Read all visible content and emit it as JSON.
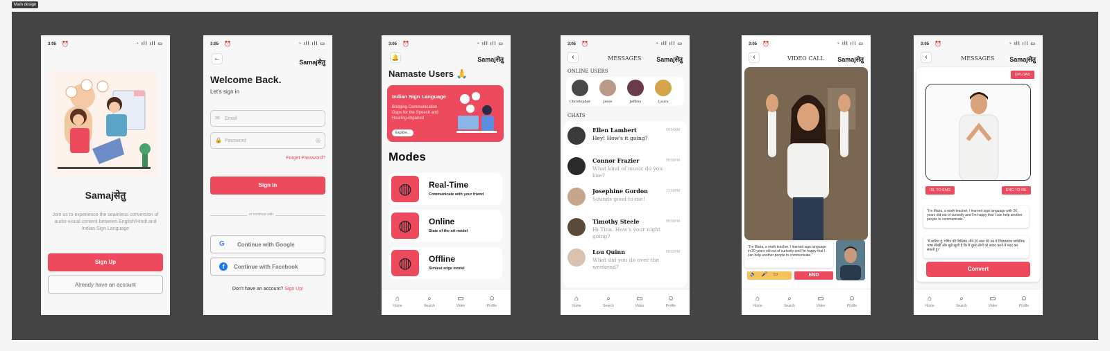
{
  "frame_label": "Main design",
  "status": {
    "time": "3:05",
    "icons": "◔ ıll ıll ▭"
  },
  "brand": "Samajसेतु",
  "screen1": {
    "title": "Samajसेतु",
    "description": "Join us to experience the seamless conversion of audio-visual content between English/Hindi and Indian Sign Language",
    "signup": "Sign Up",
    "account": "Already have an account"
  },
  "screen2": {
    "back": "←",
    "welcome": "Welcome Back.",
    "subtitle": "Let's sign in",
    "email_placeholder": "Email",
    "password_placeholder": "Password",
    "forgot": "Forget Password?",
    "signin": "Sign In",
    "divider": "or continue with",
    "google": "Continue with Google",
    "facebook": "Continue with Facebook",
    "no_account": "Don't have an account?",
    "signup_link": "Sign Up!"
  },
  "screen3": {
    "greeting": "Namaste Users 🙏",
    "banner_title": "Indian Sign Language",
    "banner_text": "Bridging Communication Gaps for the Speech and Hearing-impaired",
    "banner_btn": "Explore...",
    "modes_title": "Modes",
    "modes": [
      {
        "title": "Real-Time",
        "sub": "Communicate with your friend"
      },
      {
        "title": "Online",
        "sub": "State of the art model"
      },
      {
        "title": "Offline",
        "sub": "Simlest edge model"
      }
    ]
  },
  "nav": [
    {
      "icon": "home-icon",
      "label": "Home"
    },
    {
      "icon": "search-icon",
      "label": "Search"
    },
    {
      "icon": "video-icon",
      "label": "Video"
    },
    {
      "icon": "profile-icon",
      "label": "Profile"
    }
  ],
  "screen4": {
    "header": "MESSAGES",
    "online_label": "ONLINE USERS",
    "online_users": [
      "Christopher",
      "Jesse",
      "Jeffrey",
      "Laura"
    ],
    "chats_label": "CHATS",
    "chats": [
      {
        "name": "Ellen Lambert",
        "time": "04:04AM",
        "msg": "Hey! How's it going?"
      },
      {
        "name": "Connor Frazier",
        "time": "08:58PM",
        "msg": "What kind of music do you like?"
      },
      {
        "name": "Josephine Gordon",
        "time": "11:59PM",
        "msg": "Sounds good to me!"
      },
      {
        "name": "Timothy Steele",
        "time": "06:58PM",
        "msg": "Hi Tina. How's your night going?"
      },
      {
        "name": "Lou Quinn",
        "time": "09:02PM",
        "msg": "What did you do over the weekend?"
      }
    ]
  },
  "screen5": {
    "header": "VIDEO CALL",
    "caption": "\"I'm Maria, a math teacher. I learned sign language in 20 years old out of curiosity and I'm happy that I can help another people to communicate.\"",
    "end": "END"
  },
  "screen6": {
    "header": "MESSAGES",
    "upload": "UPLOAD",
    "isl_to_eng": "ISL TO ENG",
    "eng_to_isl": "ENG TO ISL",
    "text_en": "\"I'm Maria, a math teacher. I learned sign language with 20 years old out of curiosity and I'm happy that I can help another people to communicate.\"",
    "text_hi": "\"मैं मारिया हूं, गणित की शिक्षिका। मैंने 20 साल की उम्र में जिज्ञासावश सांकेतिक भाषा सीखी और मुझे खुशी है कि मैं दूसरे लोगों को संवाद करने में मदद कर सकती हूं।\"",
    "convert": "Convert"
  },
  "colors": {
    "accent": "#ee4a5e",
    "canvas": "#444444"
  }
}
